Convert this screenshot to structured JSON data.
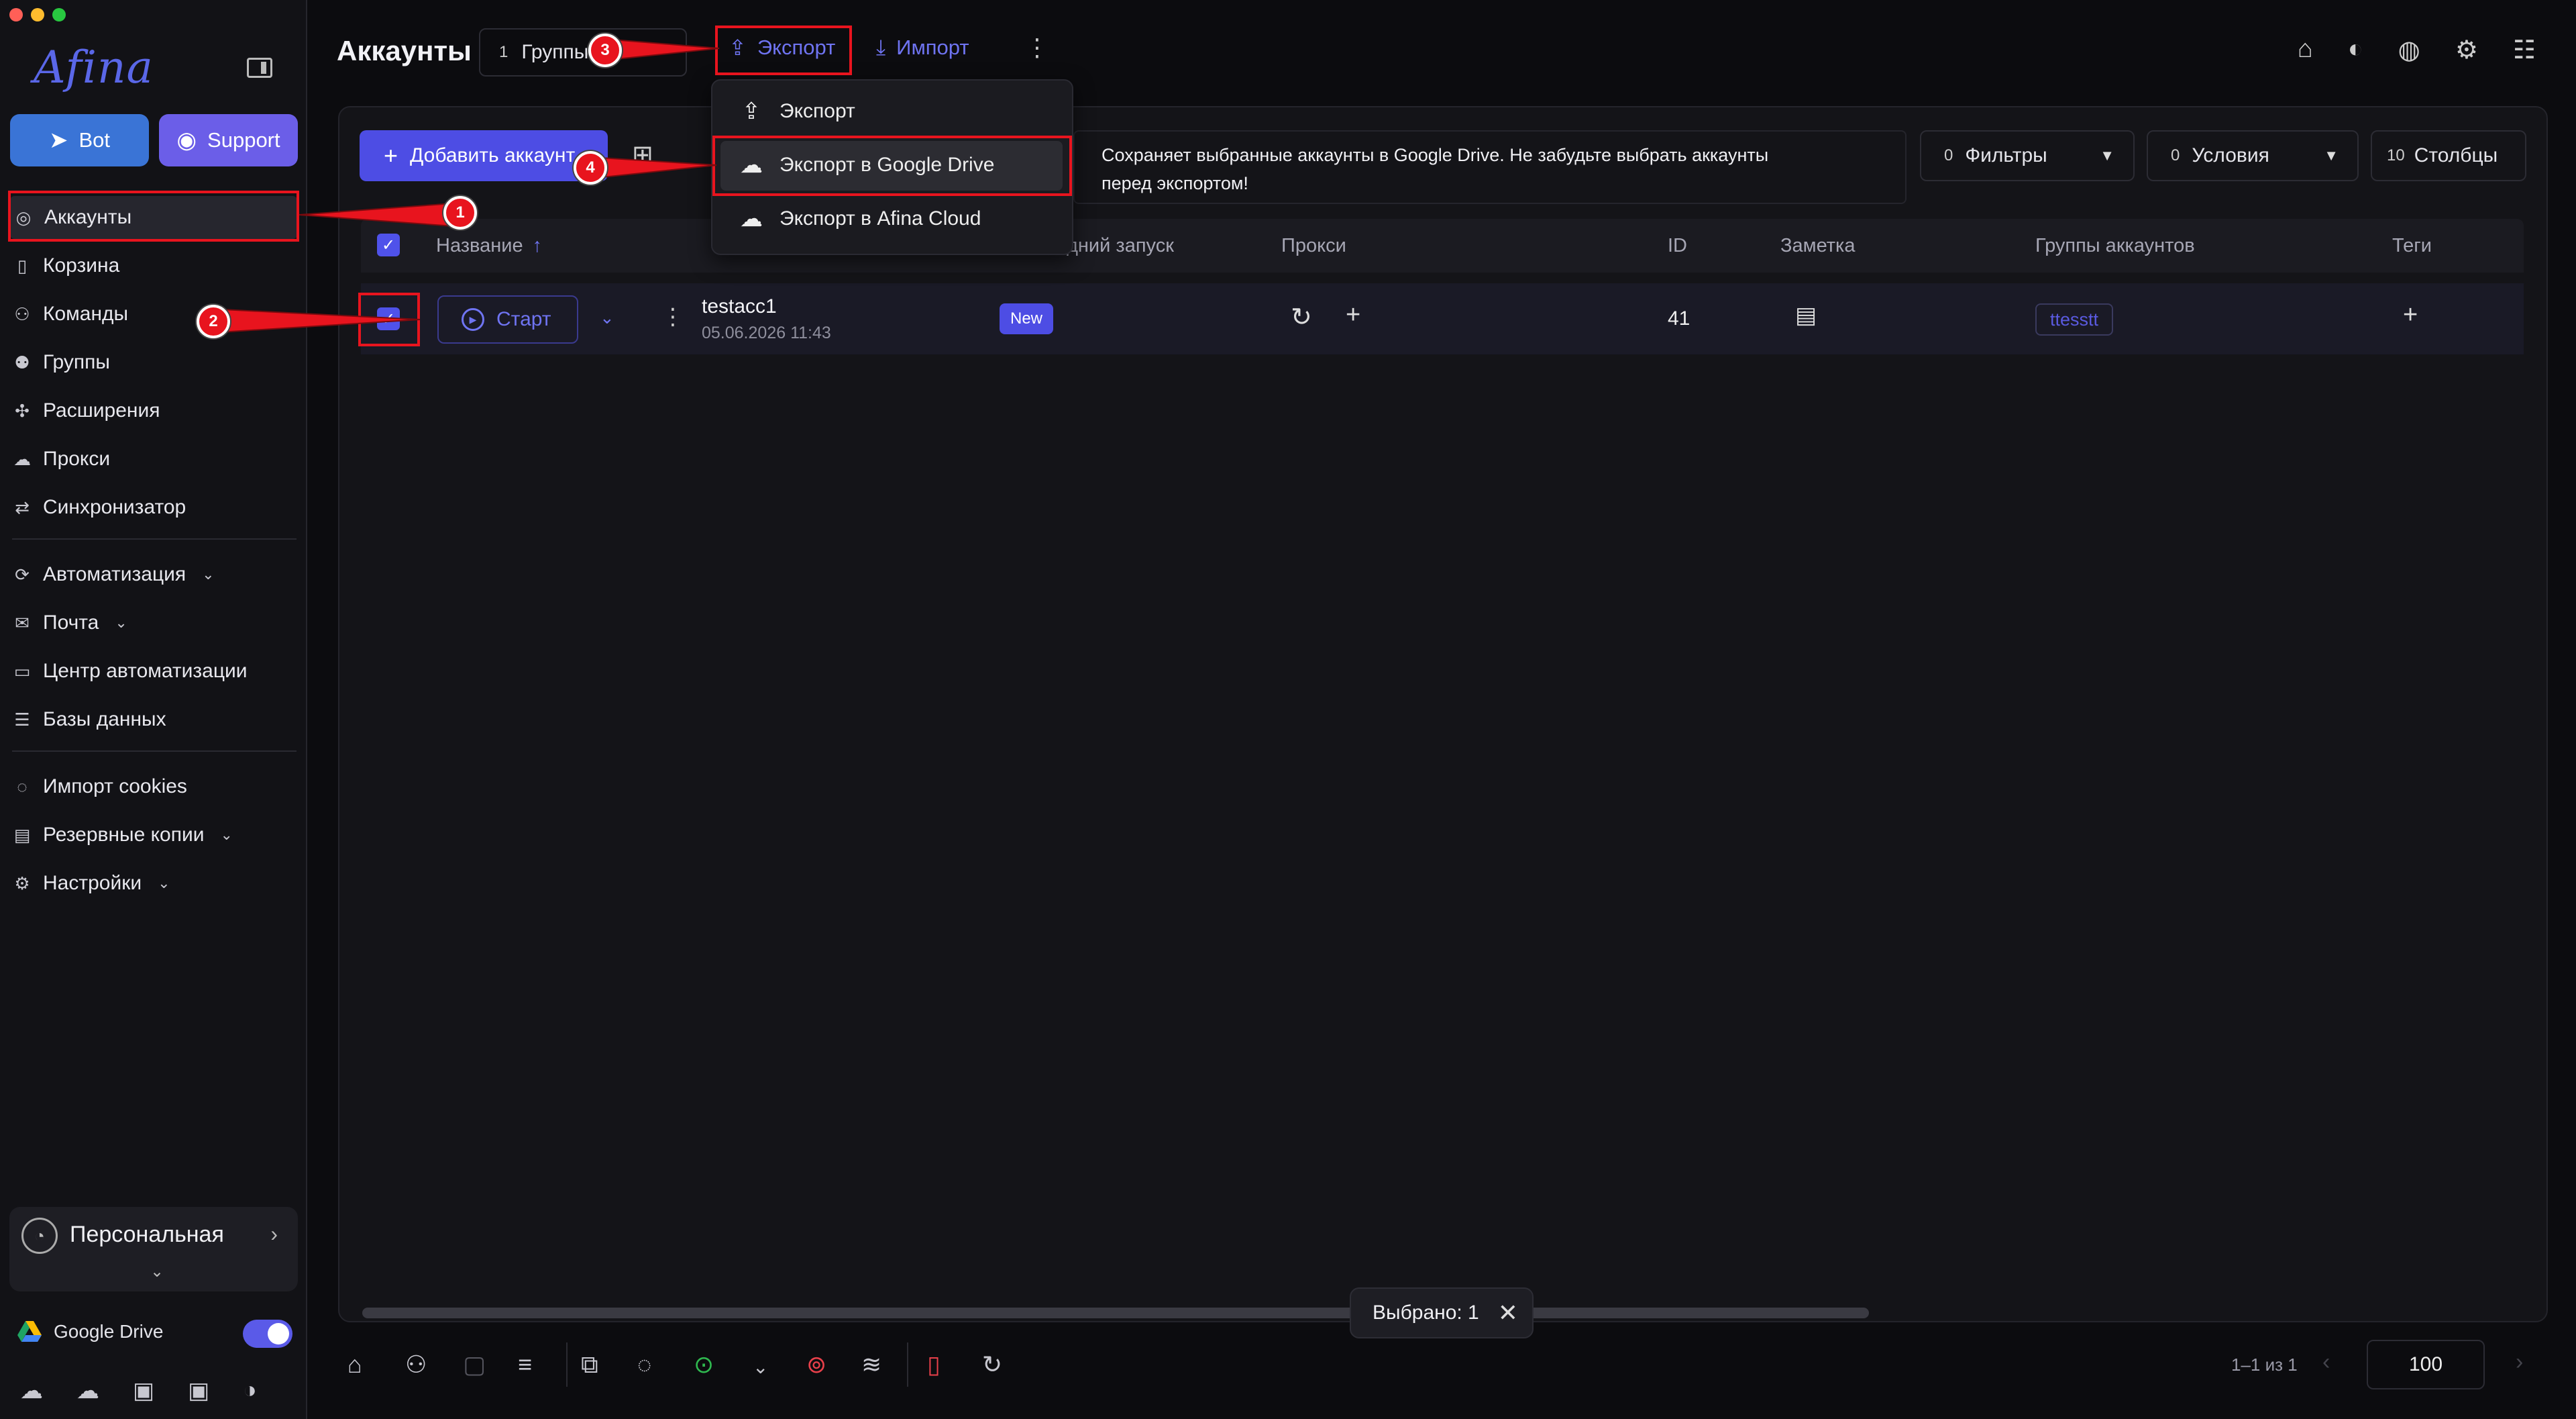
{
  "app": {
    "logo": "Afina"
  },
  "sidebar": {
    "bot_label": "Bot",
    "support_label": "Support",
    "items": [
      {
        "label": "Аккаунты",
        "icon": "user-circle-icon"
      },
      {
        "label": "Корзина",
        "icon": "trash-icon"
      },
      {
        "label": "Команды",
        "icon": "team-icon"
      },
      {
        "label": "Группы",
        "icon": "groups-icon"
      },
      {
        "label": "Расширения",
        "icon": "puzzle-icon"
      },
      {
        "label": "Прокси",
        "icon": "cloud-icon"
      },
      {
        "label": "Синхронизатор",
        "icon": "sync-icon"
      },
      {
        "label": "Автоматизация",
        "icon": "automation-icon"
      },
      {
        "label": "Почта",
        "icon": "mail-icon"
      },
      {
        "label": "Центр автоматизации",
        "icon": "laptop-icon"
      },
      {
        "label": "Базы данных",
        "icon": "list-icon"
      },
      {
        "label": "Импорт cookies",
        "icon": "cookie-icon"
      },
      {
        "label": "Резервные копии",
        "icon": "backup-icon"
      },
      {
        "label": "Настройки",
        "icon": "gear-icon"
      }
    ],
    "workspace": "Персональная",
    "gdrive_label": "Google Drive"
  },
  "header": {
    "title": "Аккаунты",
    "groups_count": "1",
    "groups_label": "Группы",
    "export_label": "Экспорт",
    "import_label": "Импорт"
  },
  "toolbar": {
    "add_account": "Добавить аккаунт",
    "tooltip": "Сохраняет выбранные аккаунты в Google Drive. Не забудьте выбрать аккаунты перед экспортом!",
    "filters_count": "0",
    "filters_label": "Фильтры",
    "conditions_count": "0",
    "conditions_label": "Условия",
    "columns_count": "10",
    "columns_label": "Столбцы"
  },
  "table": {
    "columns": {
      "name": "Название",
      "last_launch": "дний запуск",
      "proxy": "Прокси",
      "id": "ID",
      "note": "Заметка",
      "groups": "Группы аккаунтов",
      "tags": "Теги"
    },
    "rows": [
      {
        "start_label": "Старт",
        "name": "testacc1",
        "date": "05.06.2026 11:43",
        "badge": "New",
        "id": "41",
        "group": "ttesstt"
      }
    ]
  },
  "dropdown": {
    "items": [
      "Экспорт",
      "Экспорт в Google Drive",
      "Экспорт в Afina Cloud"
    ]
  },
  "selection": {
    "label": "Выбрано: 1"
  },
  "pager": {
    "range": "1–1 из 1",
    "page_size": "100"
  },
  "annotations": [
    "1",
    "2",
    "3",
    "4"
  ],
  "colors": {
    "accent": "#4d4de4",
    "annotation": "#e8141e",
    "bot": "#3a74d6",
    "support": "#6b5ee8"
  }
}
